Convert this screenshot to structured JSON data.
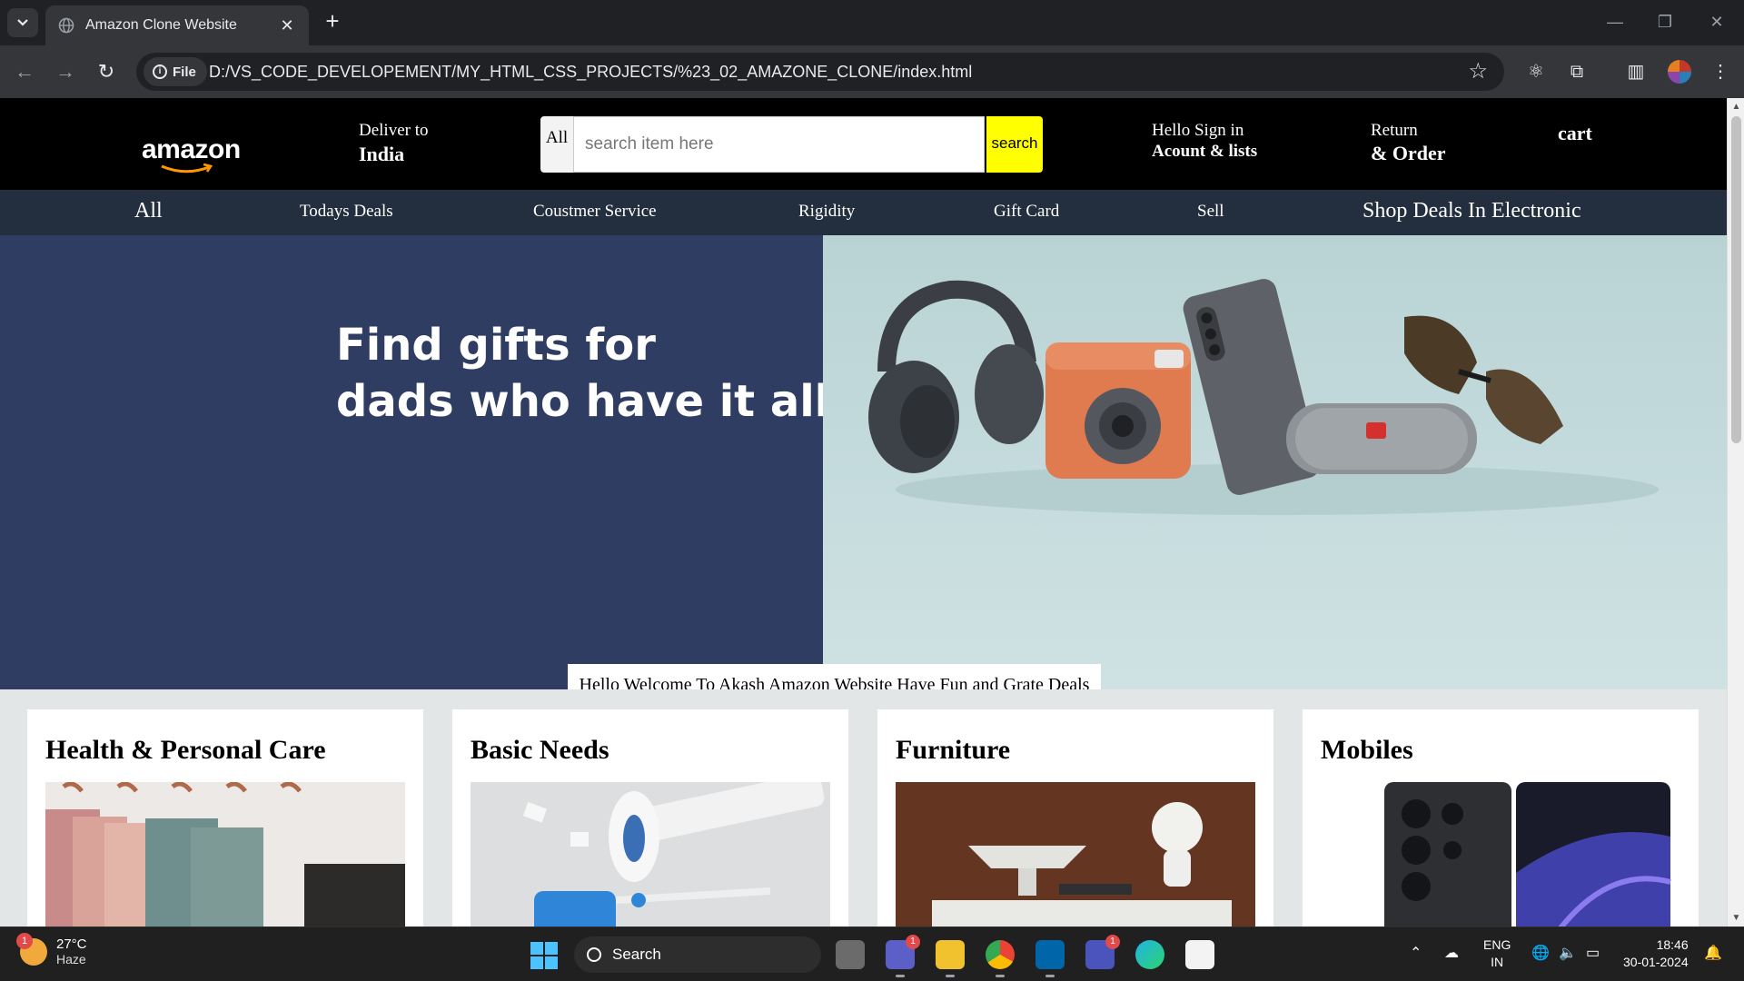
{
  "browser": {
    "tab_title": "Amazon Clone Website",
    "site_chip": "File",
    "url": "D:/VS_CODE_DEVELOPEMENT/MY_HTML_CSS_PROJECTS/%23_02_AMAZONE_CLONE/index.html"
  },
  "navbar": {
    "logo": "amazon",
    "deliver_line1": "Deliver to",
    "deliver_line2": "India",
    "search_category": "All",
    "search_placeholder": "search item here",
    "search_button": "search",
    "signin_line1": "Hello Sign in",
    "signin_line2": "Acount & lists",
    "returns_line1": "Return",
    "returns_line2": "& Order",
    "cart": "cart"
  },
  "subnav": {
    "items": [
      "All",
      "Todays Deals",
      "Coustmer Service",
      "Rigidity",
      "Gift Card",
      "Sell",
      "Shop Deals In Electronic"
    ]
  },
  "hero": {
    "headline_line1": "Find gifts for",
    "headline_line2": "dads who have it all",
    "welcome_message": "Hello Welcome To Akash Amazon Website Have Fun and Grate Deals"
  },
  "cards": [
    {
      "title": "Health & Personal Care"
    },
    {
      "title": "Basic Needs"
    },
    {
      "title": "Furniture"
    },
    {
      "title": "Mobiles"
    }
  ],
  "taskbar": {
    "weather_temp": "27°C",
    "weather_desc": "Haze",
    "weather_badge": "1",
    "search_label": "Search",
    "lang_line1": "ENG",
    "lang_line2": "IN",
    "time": "18:46",
    "date": "30-01-2024",
    "teams_badge": "1",
    "chat_badge": "1"
  },
  "colors": {
    "navbar_bg": "#000000",
    "subnav_bg": "#232f3e",
    "hero_bg": "#2f3d62",
    "search_button_bg": "#ffff00",
    "page_bg": "#e3e6e6"
  }
}
